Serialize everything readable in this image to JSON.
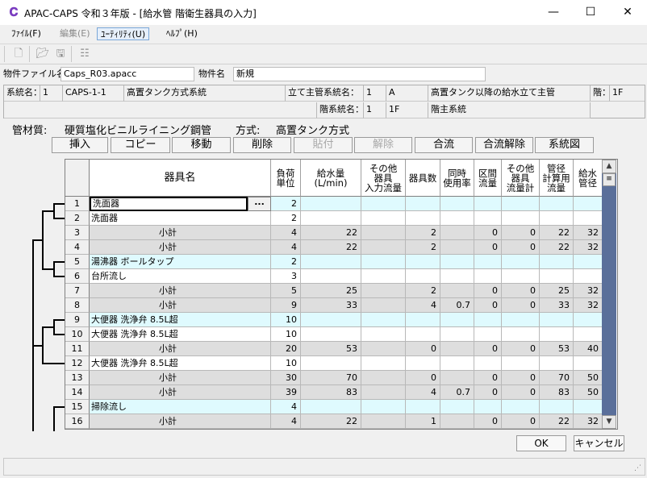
{
  "window": {
    "title": "APAC-CAPS 令和３年版 - [給水管 階衛生器具の入力]",
    "minimize": "—",
    "maximize": "☐",
    "close": "✕"
  },
  "menu": [
    {
      "label": "ﾌｧｲﾙ(F)",
      "enabled": true
    },
    {
      "label": "編集(E)",
      "enabled": false
    },
    {
      "label": "ﾕｰﾃｨﾘﾃｨ(U)",
      "enabled": true
    },
    {
      "label": "ﾍﾙﾌﾟ(H)",
      "enabled": true
    }
  ],
  "toolbar": {
    "icons": [
      "new-file-icon",
      "open-folder-icon",
      "save-icon",
      "tree-icon"
    ]
  },
  "file_info": {
    "file_label": "物件ファイル名",
    "file_value": "Caps_R03.apacc",
    "name_label": "物件名",
    "name_value": "新規"
  },
  "system": {
    "sys_label": "系統名：",
    "sys_no": "1",
    "sys_code": "CAPS-1-1",
    "sys_name": "高置タンク方式系統",
    "riser_label": "立て主管系統名：",
    "riser_no": "1",
    "riser_code": "A",
    "riser_name": "高置タンク以降の給水立て主管",
    "floor_label": "階：",
    "floor_value": "1F",
    "floorsys_label": "階系統名：",
    "floorsys_no": "1",
    "floorsys_code": "1F",
    "floorsys_name": "階主系統"
  },
  "material": {
    "label": "管材質:",
    "value": "硬質塩化ビニルライニング鋼管",
    "method_label": "方式:",
    "method_value": "高置タンク方式"
  },
  "buttons": [
    {
      "label": "挿入",
      "enabled": true
    },
    {
      "label": "コピー",
      "enabled": true
    },
    {
      "label": "移動",
      "enabled": true
    },
    {
      "label": "削除",
      "enabled": true
    },
    {
      "label": "貼付",
      "enabled": false
    },
    {
      "label": "解除",
      "enabled": false
    },
    {
      "label": "合流",
      "enabled": true
    },
    {
      "label": "合流解除",
      "enabled": true
    },
    {
      "label": "系統図",
      "enabled": true
    }
  ],
  "table": {
    "headers": [
      "",
      "器具名",
      "負荷\n単位",
      "給水量\n(L/min)",
      "その他\n器具\n入力流量",
      "器具数",
      "同時\n使用率",
      "区間\n流量",
      "その他\n器具\n流量計",
      "管径\n計算用\n流量",
      "給水\n管径"
    ],
    "ellipsis": "...",
    "rows": [
      {
        "n": "1",
        "name": "洗面器",
        "sub": false,
        "style": "cyan",
        "load": "2",
        "water": "",
        "other": "",
        "count": "",
        "rate": "",
        "flow": "",
        "oflow": "",
        "calc": "",
        "dia": ""
      },
      {
        "n": "2",
        "name": "洗面器",
        "sub": false,
        "style": "white",
        "load": "2",
        "water": "",
        "other": "",
        "count": "",
        "rate": "",
        "flow": "",
        "oflow": "",
        "calc": "",
        "dia": ""
      },
      {
        "n": "3",
        "name": "小計",
        "sub": true,
        "style": "gray",
        "load": "4",
        "water": "22",
        "other": "",
        "count": "2",
        "rate": "",
        "flow": "0",
        "oflow": "0",
        "calc": "22",
        "dia": "32"
      },
      {
        "n": "4",
        "name": "小計",
        "sub": true,
        "style": "gray",
        "load": "4",
        "water": "22",
        "other": "",
        "count": "2",
        "rate": "",
        "flow": "0",
        "oflow": "0",
        "calc": "22",
        "dia": "32"
      },
      {
        "n": "5",
        "name": "湯沸器 ボールタップ",
        "sub": false,
        "style": "cyan",
        "load": "2",
        "water": "",
        "other": "",
        "count": "",
        "rate": "",
        "flow": "",
        "oflow": "",
        "calc": "",
        "dia": ""
      },
      {
        "n": "6",
        "name": "台所流し",
        "sub": false,
        "style": "white",
        "load": "3",
        "water": "",
        "other": "",
        "count": "",
        "rate": "",
        "flow": "",
        "oflow": "",
        "calc": "",
        "dia": ""
      },
      {
        "n": "7",
        "name": "小計",
        "sub": true,
        "style": "gray",
        "load": "5",
        "water": "25",
        "other": "",
        "count": "2",
        "rate": "",
        "flow": "0",
        "oflow": "0",
        "calc": "25",
        "dia": "32"
      },
      {
        "n": "8",
        "name": "小計",
        "sub": true,
        "style": "gray",
        "load": "9",
        "water": "33",
        "other": "",
        "count": "4",
        "rate": "0.7",
        "flow": "0",
        "oflow": "0",
        "calc": "33",
        "dia": "32"
      },
      {
        "n": "9",
        "name": "大便器 洗浄弁 8.5L超",
        "sub": false,
        "style": "cyan",
        "load": "10",
        "water": "",
        "other": "",
        "count": "",
        "rate": "",
        "flow": "",
        "oflow": "",
        "calc": "",
        "dia": ""
      },
      {
        "n": "10",
        "name": "大便器 洗浄弁 8.5L超",
        "sub": false,
        "style": "white",
        "load": "10",
        "water": "",
        "other": "",
        "count": "",
        "rate": "",
        "flow": "",
        "oflow": "",
        "calc": "",
        "dia": ""
      },
      {
        "n": "11",
        "name": "小計",
        "sub": true,
        "style": "gray",
        "load": "20",
        "water": "53",
        "other": "",
        "count": "0",
        "rate": "",
        "flow": "0",
        "oflow": "0",
        "calc": "53",
        "dia": "40"
      },
      {
        "n": "12",
        "name": "大便器 洗浄弁 8.5L超",
        "sub": false,
        "style": "white",
        "load": "10",
        "water": "",
        "other": "",
        "count": "",
        "rate": "",
        "flow": "",
        "oflow": "",
        "calc": "",
        "dia": ""
      },
      {
        "n": "13",
        "name": "小計",
        "sub": true,
        "style": "gray",
        "load": "30",
        "water": "70",
        "other": "",
        "count": "0",
        "rate": "",
        "flow": "0",
        "oflow": "0",
        "calc": "70",
        "dia": "50"
      },
      {
        "n": "14",
        "name": "小計",
        "sub": true,
        "style": "gray",
        "load": "39",
        "water": "83",
        "other": "",
        "count": "4",
        "rate": "0.7",
        "flow": "0",
        "oflow": "0",
        "calc": "83",
        "dia": "50"
      },
      {
        "n": "15",
        "name": "掃除流し",
        "sub": false,
        "style": "cyan",
        "load": "4",
        "water": "",
        "other": "",
        "count": "",
        "rate": "",
        "flow": "",
        "oflow": "",
        "calc": "",
        "dia": ""
      },
      {
        "n": "16",
        "name": "小計",
        "sub": true,
        "style": "gray",
        "load": "4",
        "water": "22",
        "other": "",
        "count": "1",
        "rate": "",
        "flow": "0",
        "oflow": "0",
        "calc": "22",
        "dia": "32"
      }
    ]
  },
  "footer": {
    "ok": "OK",
    "cancel": "キャンセル"
  }
}
